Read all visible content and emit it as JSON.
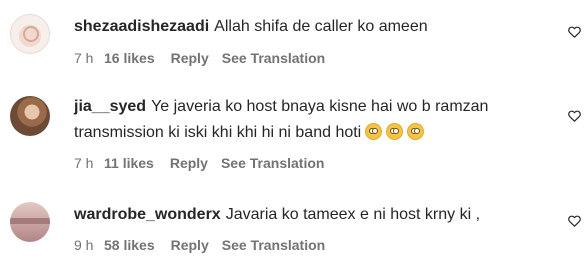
{
  "comments": [
    {
      "username": "shezaadishezaadi",
      "text": "Allah shifa de caller ko ameen",
      "time": "7 h",
      "likes": "16 likes",
      "reply_label": "Reply",
      "translate_label": "See Translation"
    },
    {
      "username": "jia__syed",
      "text": "Ye javeria ko host bnaya kisne hai wo b ramzan",
      "text_line2": "transmission ki iski khi khi hi ni band hoti",
      "emoji_count": 3,
      "time": "7 h",
      "likes": "11 likes",
      "reply_label": "Reply",
      "translate_label": "See Translation"
    },
    {
      "username": "wardrobe_wonderx",
      "text": "Javaria ko tameex e ni host krny ki ,",
      "time": "9 h",
      "likes": "58 likes",
      "reply_label": "Reply",
      "translate_label": "See Translation"
    }
  ],
  "icons": {
    "like": "heart-outline-icon",
    "emoji": "face-with-rolling-eyes-emoji"
  }
}
